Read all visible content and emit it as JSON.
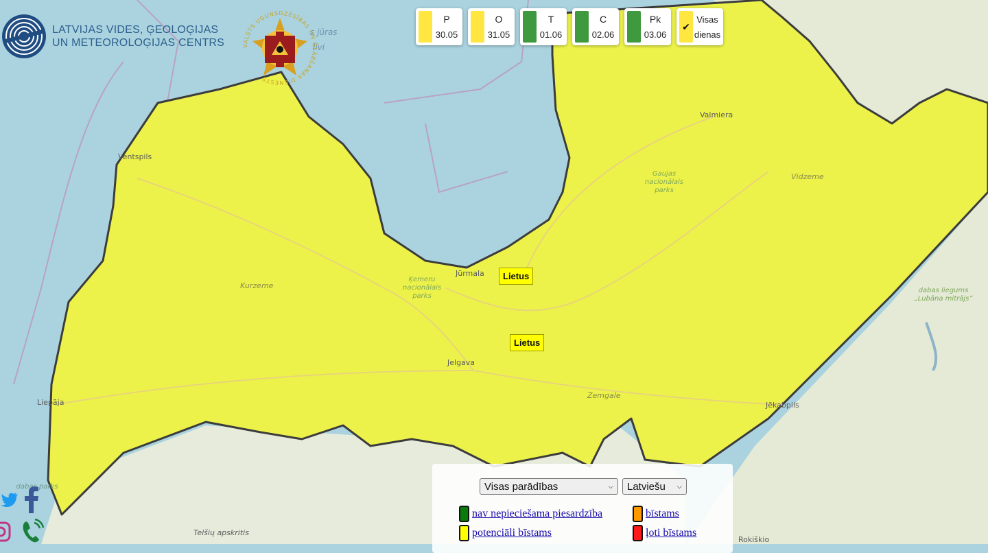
{
  "header": {
    "org_line1": "LATVIJAS VIDES, ĢEOLOĢIJAS",
    "org_line2": "UN METEOROLOĢIJAS CENTRS",
    "emblem_text": "VALSTS UGUNSDZĒSĪBAS UN GLĀBŠANAS DIENESTS"
  },
  "days": [
    {
      "day": "P",
      "date": "30.05",
      "color": "#ffe640"
    },
    {
      "day": "O",
      "date": "31.05",
      "color": "#ffe640"
    },
    {
      "day": "T",
      "date": "01.06",
      "color": "#3f9a3f"
    },
    {
      "day": "C",
      "date": "02.06",
      "color": "#3f9a3f"
    },
    {
      "day": "Pk",
      "date": "03.06",
      "color": "#3f9a3f"
    }
  ],
  "all_days": {
    "line1": "Visas",
    "line2": "dienas",
    "color": "#ffe640",
    "checked": true
  },
  "warnings": [
    {
      "label": "Lietus"
    },
    {
      "label": "Lietus"
    }
  ],
  "map_labels": {
    "ventspils": "Ventspils",
    "liepaja": "Liepāja",
    "kurzeme": "Kurzeme",
    "jurmala": "Jūrmala",
    "kemeru": "Ķemeru nacionālais parks",
    "jelgava": "Jelgava",
    "zemgale": "Zemgale",
    "jekabpils": "Jēkabpils",
    "valmiera": "Valmiera",
    "gaujas": "Gaujas nacionālais parks",
    "vidzeme": "Vidzeme",
    "lubana": "dabas liegums „Lubāna mitrājs”",
    "telsiu": "Telšių apskritis",
    "rokiskio": "Rokiškio",
    "sea1": "s jūras",
    "sea2": "līvi",
    "dabas_parks": "dabas parks"
  },
  "legend": {
    "filter_value": "Visas parādības",
    "language_value": "Latviešu",
    "items": [
      {
        "label": "nav nepieciešama piesardzība",
        "color": "#0a7a0a"
      },
      {
        "label": "bīstams",
        "color": "#ff9900"
      },
      {
        "label": "potenciāli bīstams",
        "color": "#ffff00"
      },
      {
        "label": "ļoti bīstams",
        "color": "#ff1a1a"
      }
    ]
  },
  "colors": {
    "sea": "#aad3df",
    "warning_fill": "#ecf24a",
    "border": "#3c3c3c"
  }
}
